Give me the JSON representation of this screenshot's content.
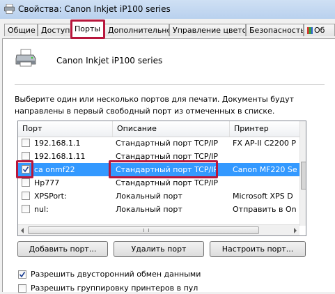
{
  "window": {
    "title": "Свойства: Canon Inkjet iP100 series"
  },
  "tabs": [
    {
      "label": "Общие"
    },
    {
      "label": "Доступ"
    },
    {
      "label": "Порты"
    },
    {
      "label": "Дополнительно"
    },
    {
      "label": "Управление цветом"
    },
    {
      "label": "Безопасность"
    },
    {
      "label": "Об"
    }
  ],
  "printer": {
    "name": "Canon Inkjet iP100 series"
  },
  "instructions": "Выберите один или несколько портов для печати. Документы будут направлены в первый свободный порт из отмеченных в списке.",
  "ports": {
    "columns": {
      "port": "Порт",
      "description": "Описание",
      "printer": "Принтер"
    },
    "rows": [
      {
        "port": "192.168.1.1",
        "description": "Стандартный порт TCP/IP",
        "printer": "FX AP-II C2200 P",
        "checked": false,
        "selected": false
      },
      {
        "port": "192.168.1.11",
        "description": "Стандартный порт TCP/IP",
        "printer": "",
        "checked": false,
        "selected": false
      },
      {
        "port": "ca onmf22",
        "description": "Стандартный порт TCP/IP",
        "printer": "Canon MF220 Se",
        "checked": true,
        "selected": true
      },
      {
        "port": "Hp777",
        "description": "Стандартный порт TCP/IP",
        "printer": "",
        "checked": false,
        "selected": false
      },
      {
        "port": "XPSPort:",
        "description": "Локальный порт",
        "printer": "Microsoft XPS D",
        "checked": false,
        "selected": false
      },
      {
        "port": "nul:",
        "description": "Локальный порт",
        "printer": "Отправить в On",
        "checked": false,
        "selected": false
      }
    ]
  },
  "buttons": {
    "add": "Добавить порт...",
    "delete": "Удалить порт",
    "configure": "Настроить порт..."
  },
  "options": {
    "bidirectional": {
      "label": "Разрешить двусторонний обмен данными",
      "checked": true
    },
    "pooling": {
      "label": "Разрешить группировку принтеров в пул",
      "checked": false
    }
  },
  "colors": {
    "highlight": "#b8163c",
    "selection": "#3399ff"
  }
}
